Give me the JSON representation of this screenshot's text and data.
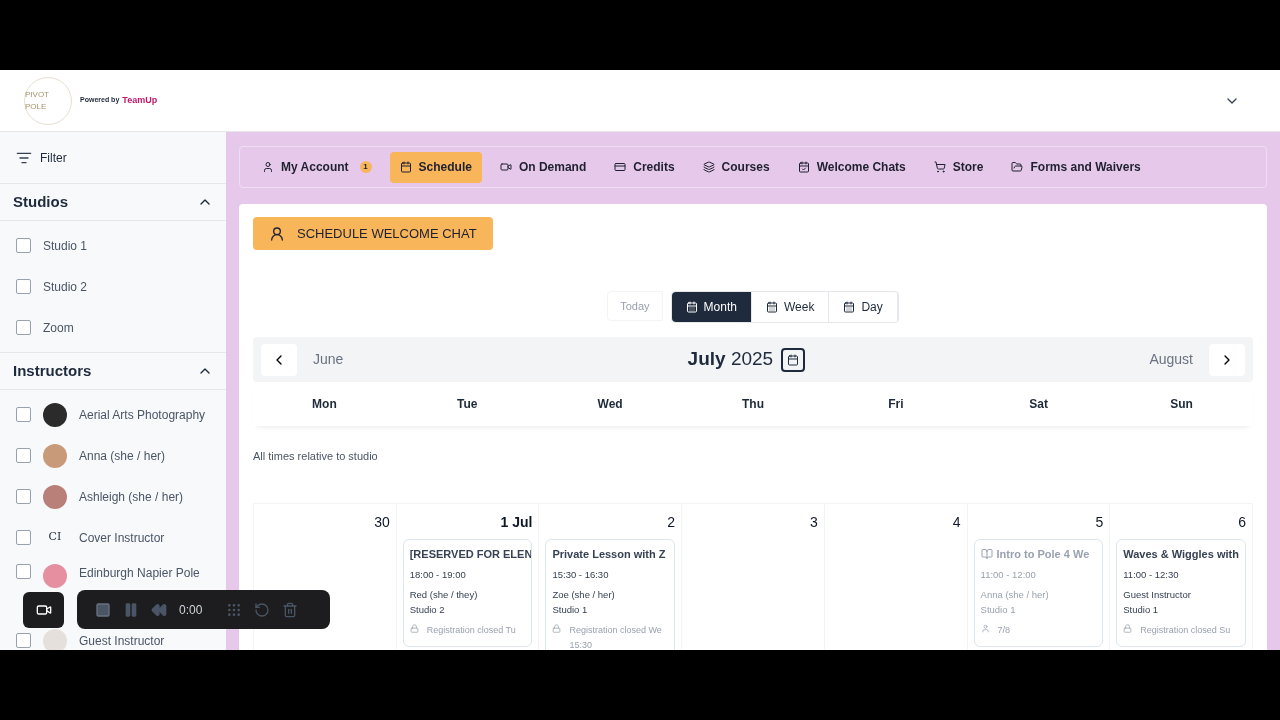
{
  "header": {
    "logo_text": "PIVOT POLE",
    "powered_by": "Powered by",
    "brand": "TeamUp"
  },
  "sidebar": {
    "filter_label": "Filter",
    "sections": [
      {
        "title": "Studios",
        "expanded": true,
        "items": [
          {
            "label": "Studio 1",
            "checked": false
          },
          {
            "label": "Studio 2",
            "checked": false
          },
          {
            "label": "Zoom",
            "checked": false
          }
        ]
      },
      {
        "title": "Instructors",
        "expanded": true,
        "items": [
          {
            "label": "Aerial Arts Photography",
            "checked": false,
            "avatar": {
              "kind": "photo",
              "color": "#2b2b2b"
            }
          },
          {
            "label": "Anna (she / her)",
            "checked": false,
            "avatar": {
              "kind": "photo",
              "color": "#c99a7a"
            }
          },
          {
            "label": "Ashleigh (she / her)",
            "checked": false,
            "avatar": {
              "kind": "photo",
              "color": "#b9807a"
            }
          },
          {
            "label": "Cover Instructor",
            "checked": false,
            "avatar": {
              "kind": "initials",
              "initials": "CI"
            }
          },
          {
            "label": "Edinburgh Napier Pole",
            "checked": false,
            "avatar": {
              "kind": "photo",
              "color": "#e58fa0"
            }
          },
          {
            "label": "Guest Instructor",
            "checked": false,
            "avatar": {
              "kind": "photo",
              "color": "#e6e0dc"
            }
          }
        ]
      }
    ]
  },
  "nav": [
    {
      "label": "My Account",
      "selected": false,
      "badge": "1"
    },
    {
      "label": "Schedule",
      "selected": true
    },
    {
      "label": "On Demand",
      "selected": false
    },
    {
      "label": "Credits",
      "selected": false
    },
    {
      "label": "Courses",
      "selected": false
    },
    {
      "label": "Welcome Chats",
      "selected": false
    },
    {
      "label": "Store",
      "selected": false
    },
    {
      "label": "Forms and Waivers",
      "selected": false
    }
  ],
  "welcome_button": "SCHEDULE WELCOME CHAT",
  "views": {
    "today": {
      "label": "Today",
      "disabled": true
    },
    "options": [
      {
        "label": "Month",
        "selected": true
      },
      {
        "label": "Week",
        "selected": false
      },
      {
        "label": "Day",
        "selected": false
      }
    ]
  },
  "month_nav": {
    "prev": "June",
    "month": "July",
    "year": "2025",
    "next": "August"
  },
  "weekdays": [
    "Mon",
    "Tue",
    "Wed",
    "Thu",
    "Fri",
    "Sat",
    "Sun"
  ],
  "timezone_note": "All times relative to studio",
  "days": [
    {
      "date": "30",
      "bold": false
    },
    {
      "date": "1 Jul",
      "bold": true,
      "events": [
        {
          "title": "[RESERVED FOR ELEN",
          "time": "18:00 - 19:00",
          "instructor": "Red (she / they)",
          "studio": "Studio 2",
          "footer": {
            "kind": "lock",
            "text": "Registration closed  Tu"
          },
          "disabled": false
        }
      ]
    },
    {
      "date": "2",
      "bold": false,
      "events": [
        {
          "title": "Private Lesson with Z",
          "time": "15:30 - 16:30",
          "instructor": "Zoe (she / her)",
          "studio": "Studio 1",
          "footer": {
            "kind": "lock",
            "text": "Registration closed  We 15:30"
          },
          "disabled": false
        }
      ]
    },
    {
      "date": "3",
      "bold": false
    },
    {
      "date": "4",
      "bold": false
    },
    {
      "date": "5",
      "bold": false,
      "events": [
        {
          "title": "Intro to Pole 4 We",
          "course": true,
          "time": "11:00 - 12:00",
          "instructor": "Anna (she / her)",
          "studio": "Studio 1",
          "footer": {
            "kind": "capacity",
            "text": "7/8"
          },
          "disabled": true
        }
      ]
    },
    {
      "date": "6",
      "bold": false,
      "events": [
        {
          "title": "Waves & Wiggles with",
          "time": "11:00 - 12:30",
          "instructor": "Guest Instructor",
          "studio": "Studio 1",
          "footer": {
            "kind": "lock",
            "text": "Registration closed  Su"
          },
          "disabled": false
        }
      ]
    }
  ],
  "recorder": {
    "time": "0:00"
  }
}
